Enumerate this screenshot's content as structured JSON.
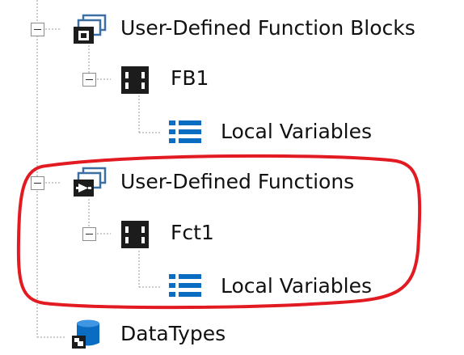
{
  "tree": {
    "nodes": [
      {
        "label": "User-Defined Function Blocks",
        "icon": "function-block-folder-icon"
      },
      {
        "label": "FB1",
        "icon": "block-icon"
      },
      {
        "label": "Local Variables",
        "icon": "list-icon"
      },
      {
        "label": "User-Defined Functions",
        "icon": "function-folder-icon"
      },
      {
        "label": "Fct1",
        "icon": "block-icon"
      },
      {
        "label": "Local Variables",
        "icon": "list-icon"
      },
      {
        "label": "DataTypes",
        "icon": "database-icon"
      }
    ],
    "highlight": {
      "color": "#e21b23",
      "target": "User-Defined Functions"
    }
  }
}
